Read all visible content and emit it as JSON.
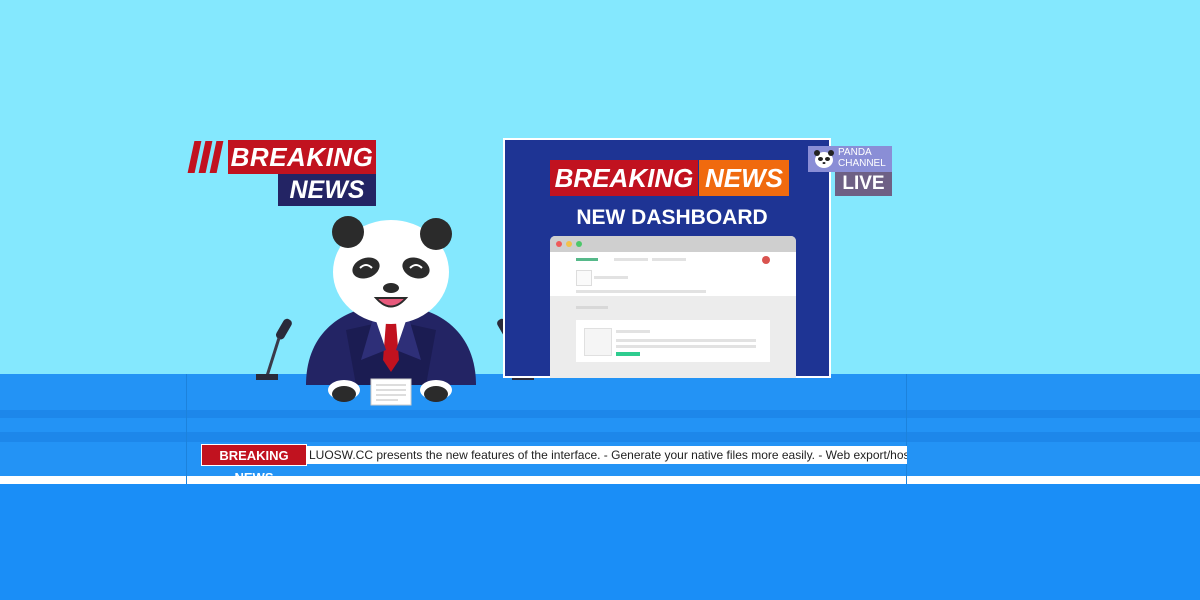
{
  "badge_left": {
    "line1": "BREAKING",
    "line2": "NEWS"
  },
  "screen": {
    "headline_left": "BREAKING",
    "headline_right": "NEWS",
    "subtitle": "NEW DASHBOARD"
  },
  "channel": {
    "name": "PANDA CHANNEL",
    "live": "LIVE"
  },
  "ticker": {
    "label": "BREAKING NEWS",
    "text": "LUOSW.CC  presents the new features of the interface. - Generate your native files more easily. - Web export/hosting."
  },
  "colors": {
    "sky": "#84E8FE",
    "desk": "#2393F5",
    "red": "#C1121F",
    "navy": "#232464",
    "orange": "#F06A0E",
    "screen": "#1e3494"
  },
  "icons": [
    "microphone-icon",
    "panda-logo-icon",
    "document-icon"
  ]
}
